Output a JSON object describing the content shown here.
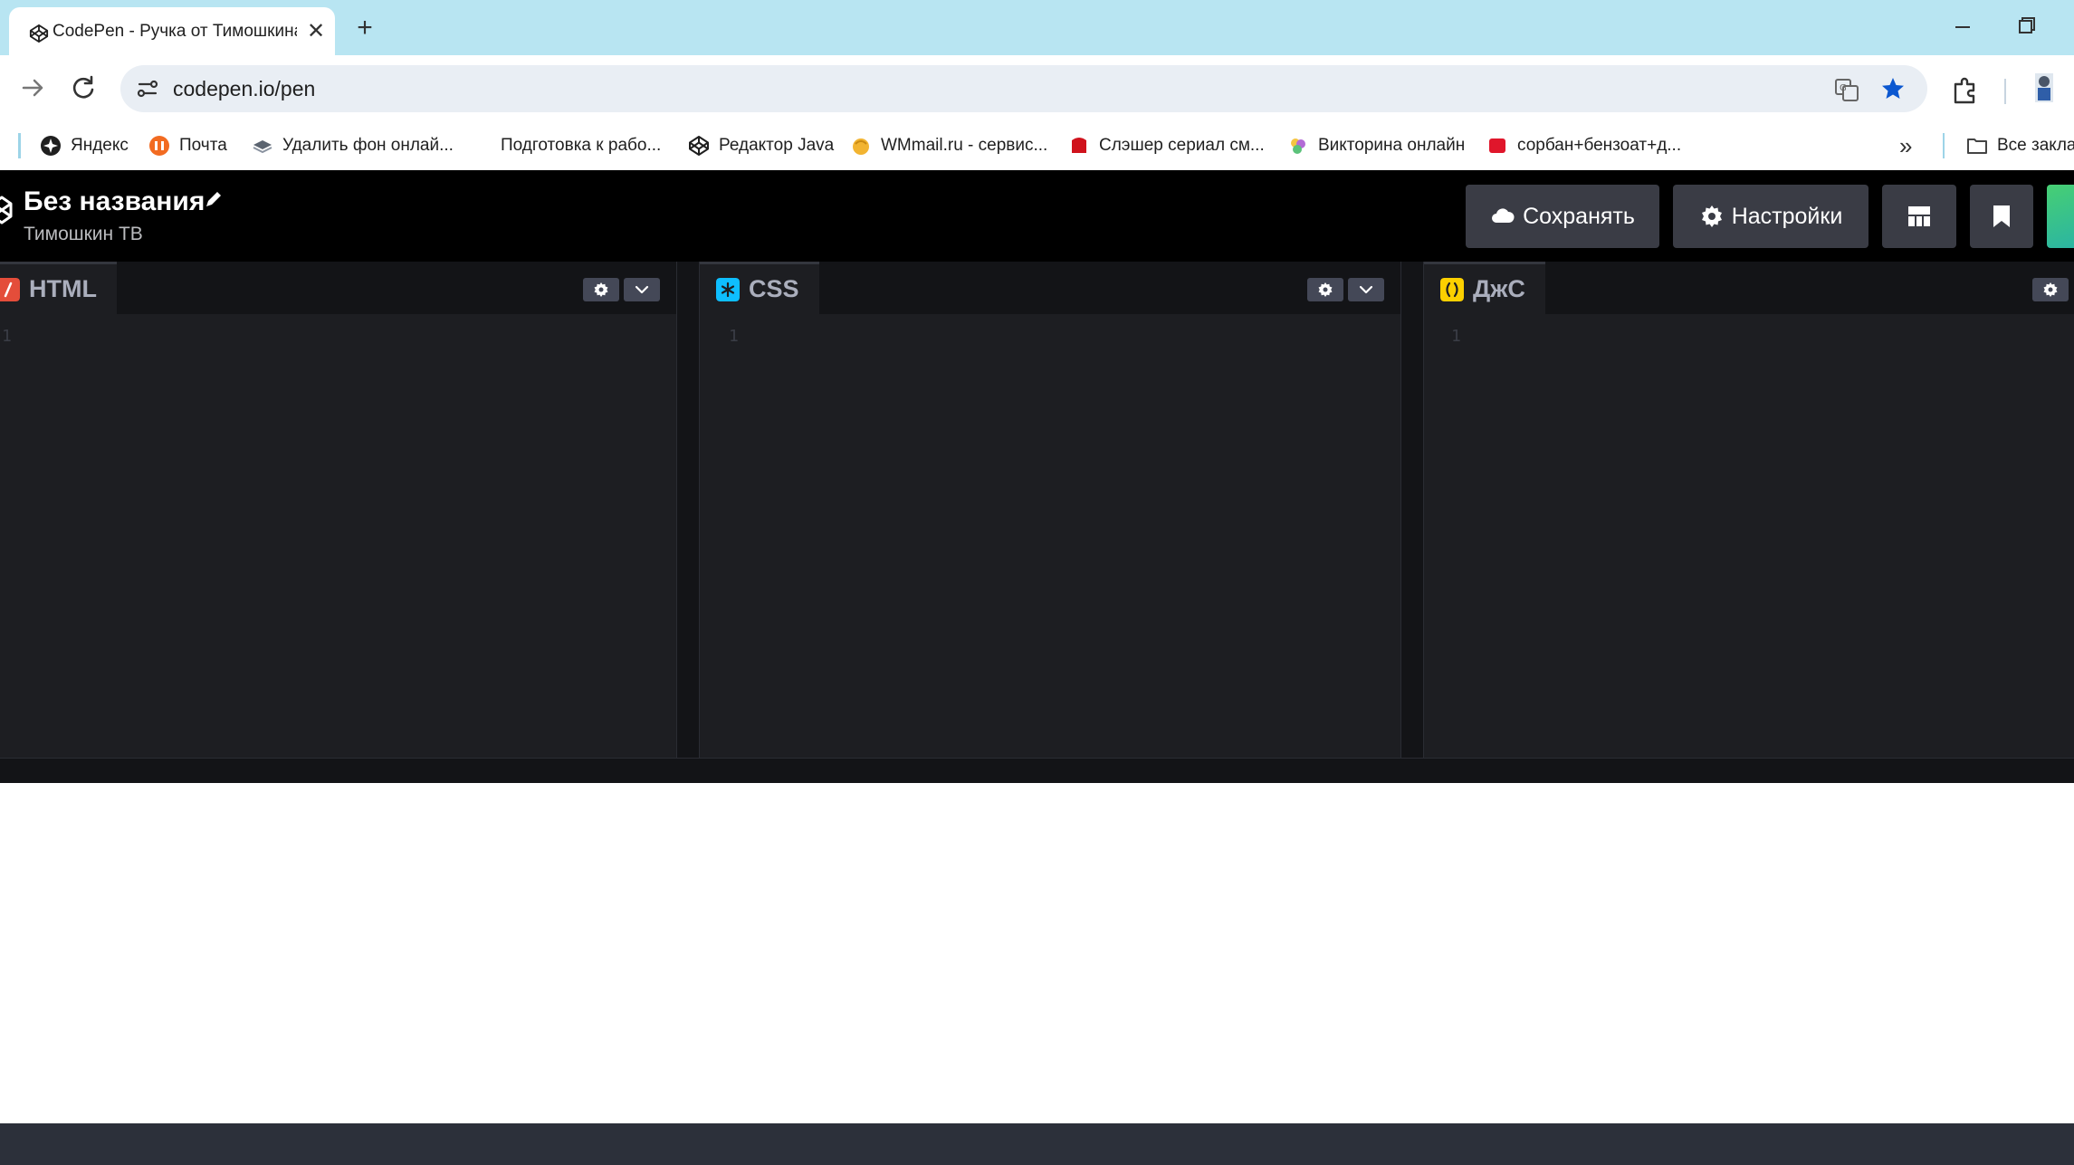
{
  "browser": {
    "tab_title": "CodePen - Ручка от Тимошкина",
    "new_tab_symbol": "+",
    "close_symbol": "✕",
    "url": "codepen.io/pen",
    "more_symbol": "»"
  },
  "bookmarks": [
    {
      "label": "Яндекс",
      "icon": "yandex-icon",
      "color": "#1f1f1f"
    },
    {
      "label": "Почта",
      "icon": "mail-icon",
      "color": "#f26b21"
    },
    {
      "label": "Удалить фон онлай...",
      "icon": "remove-bg-icon",
      "color": "#5b6470"
    },
    {
      "label": "Подготовка к рабо...",
      "icon": "none",
      "color": ""
    },
    {
      "label": "Редактор Java",
      "icon": "codepen-icon",
      "color": "#1f1f1f"
    },
    {
      "label": "WMmail.ru - сервис...",
      "icon": "wmmail-icon",
      "color": "#f2b431"
    },
    {
      "label": "Слэшер сериал см...",
      "icon": "red-icon",
      "color": "#d0121c"
    },
    {
      "label": "Викторина онлайн",
      "icon": "quiz-icon",
      "color": "#b36bd6"
    },
    {
      "label": "сорбан+бензоат+д...",
      "icon": "red-square-icon",
      "color": "#e0162b"
    }
  ],
  "bookmarks_all_label": "Все закла",
  "codepen": {
    "title": "Без названия",
    "author": "Тимошкин ТВ",
    "save_label": "Сохранять",
    "settings_label": "Настройки"
  },
  "panes": [
    {
      "lang": "HTML",
      "icon_color": "#e44d3a",
      "line": "1"
    },
    {
      "lang": "CSS",
      "icon_color": "#0ebeff",
      "line": "1"
    },
    {
      "lang": "ДжС",
      "icon_color": "#fcd000",
      "line": "1"
    }
  ]
}
